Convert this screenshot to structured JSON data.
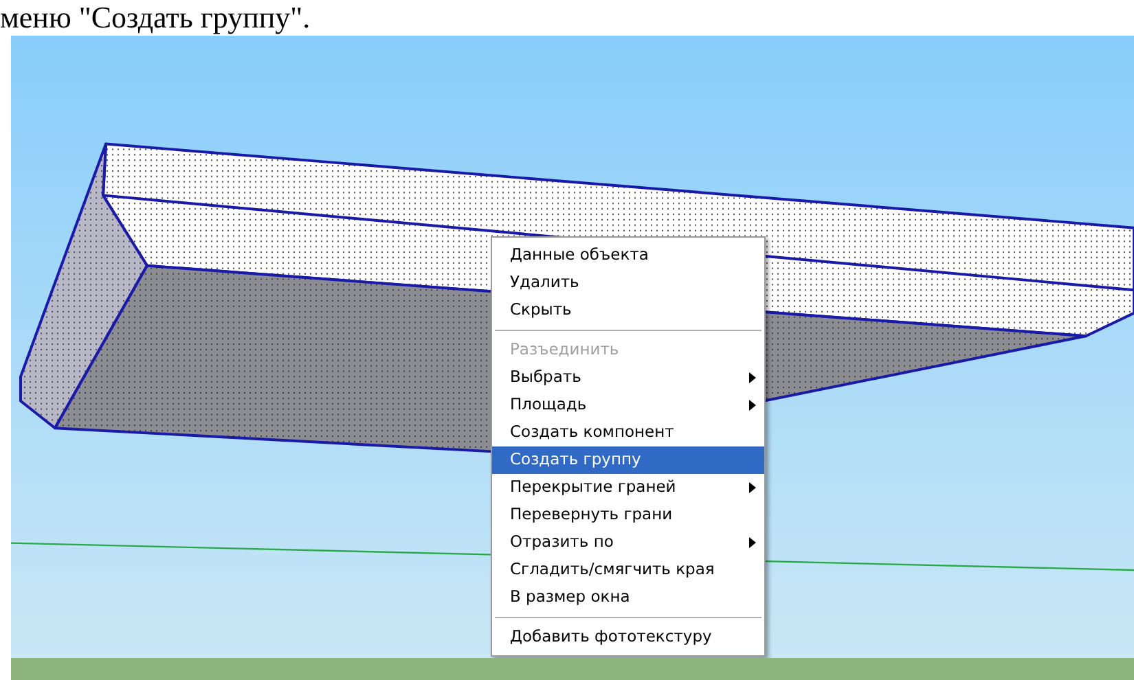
{
  "page_text": "меню \"Создать группу\".",
  "context_menu": {
    "items": [
      {
        "kind": "item",
        "label": "Данные объекта",
        "disabled": false,
        "selected": false,
        "has_submenu": false
      },
      {
        "kind": "item",
        "label": "Удалить",
        "disabled": false,
        "selected": false,
        "has_submenu": false
      },
      {
        "kind": "item",
        "label": "Скрыть",
        "disabled": false,
        "selected": false,
        "has_submenu": false
      },
      {
        "kind": "separator"
      },
      {
        "kind": "item",
        "label": "Разъединить",
        "disabled": true,
        "selected": false,
        "has_submenu": false
      },
      {
        "kind": "item",
        "label": "Выбрать",
        "disabled": false,
        "selected": false,
        "has_submenu": true
      },
      {
        "kind": "item",
        "label": "Площадь",
        "disabled": false,
        "selected": false,
        "has_submenu": true
      },
      {
        "kind": "item",
        "label": "Создать компонент",
        "disabled": false,
        "selected": false,
        "has_submenu": false
      },
      {
        "kind": "item",
        "label": "Создать группу",
        "disabled": false,
        "selected": true,
        "has_submenu": false
      },
      {
        "kind": "item",
        "label": "Перекрытие граней",
        "disabled": false,
        "selected": false,
        "has_submenu": true
      },
      {
        "kind": "item",
        "label": "Перевернуть грани",
        "disabled": false,
        "selected": false,
        "has_submenu": false
      },
      {
        "kind": "item",
        "label": "Отразить по",
        "disabled": false,
        "selected": false,
        "has_submenu": true
      },
      {
        "kind": "item",
        "label": "Сгладить/смягчить края",
        "disabled": false,
        "selected": false,
        "has_submenu": false
      },
      {
        "kind": "item",
        "label": "В размер окна",
        "disabled": false,
        "selected": false,
        "has_submenu": false
      },
      {
        "kind": "separator"
      },
      {
        "kind": "item",
        "label": "Добавить фототекстуру",
        "disabled": false,
        "selected": false,
        "has_submenu": false
      }
    ]
  }
}
